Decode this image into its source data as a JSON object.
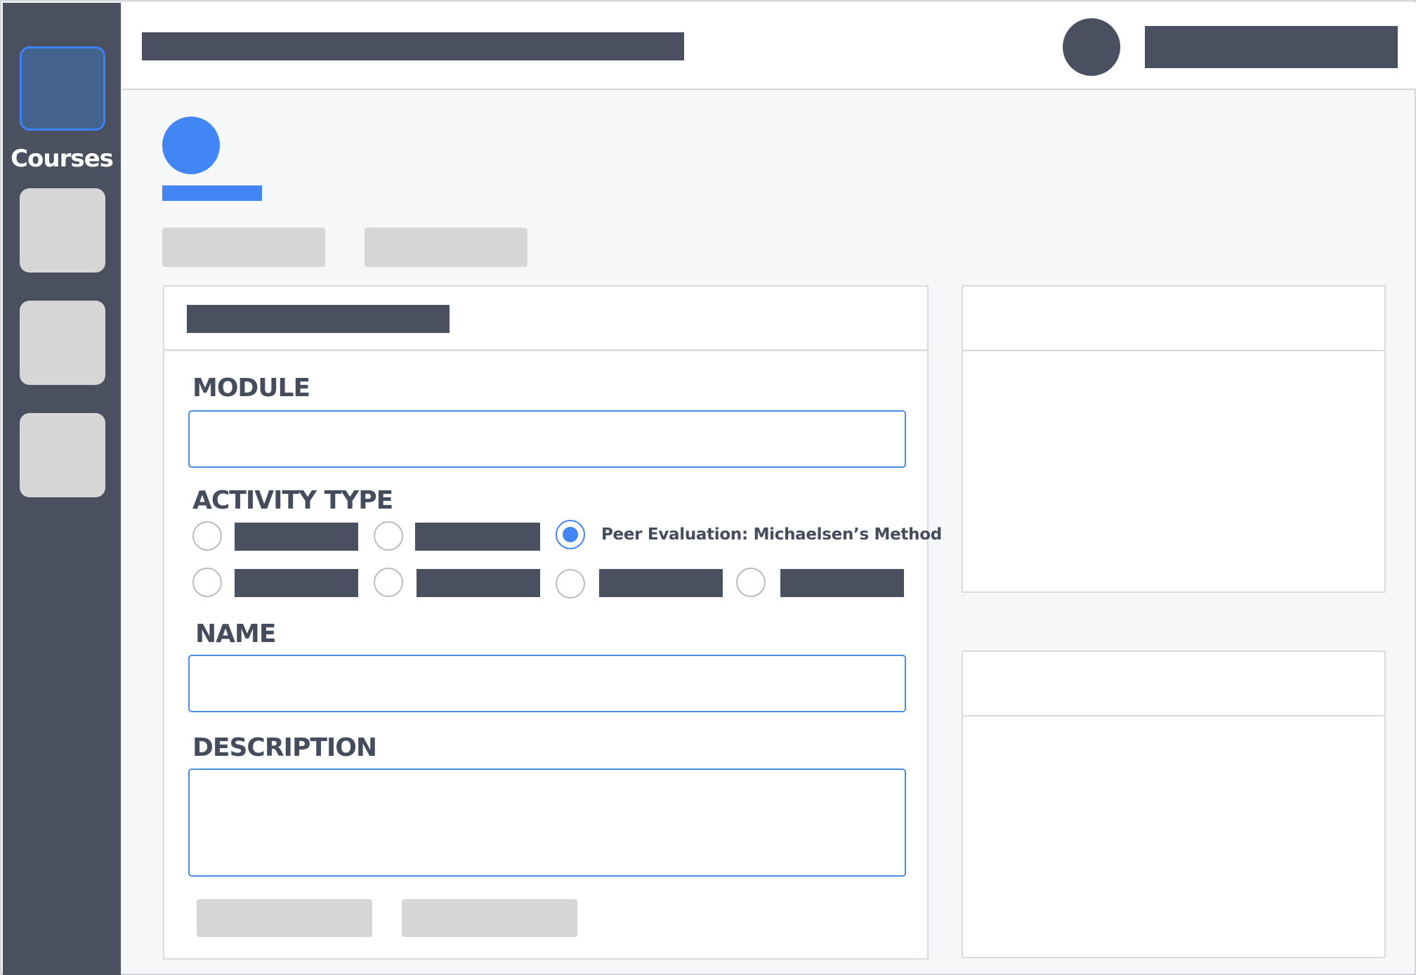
{
  "sidebar": {
    "items": [
      {
        "label": "Courses",
        "active": true
      },
      {
        "label": "",
        "active": false
      },
      {
        "label": "",
        "active": false
      },
      {
        "label": "",
        "active": false
      }
    ]
  },
  "form": {
    "module_label": "MODULE",
    "module_value": "",
    "activity_type_label": "ACTIVITY TYPE",
    "activity_options": [
      {
        "label": "",
        "selected": false
      },
      {
        "label": "",
        "selected": false
      },
      {
        "label": "Peer Evaluation: Michaelsen’s Method",
        "selected": true
      },
      {
        "label": "",
        "selected": false
      },
      {
        "label": "",
        "selected": false
      },
      {
        "label": "",
        "selected": false
      },
      {
        "label": "",
        "selected": false
      }
    ],
    "name_label": "NAME",
    "name_value": "",
    "description_label": "DESCRIPTION",
    "description_value": ""
  },
  "colors": {
    "sidebar_bg": "#4a5060",
    "accent": "#4285f4",
    "input_border": "#4a8ee0",
    "placeholder_block": "#d6d6d6"
  }
}
